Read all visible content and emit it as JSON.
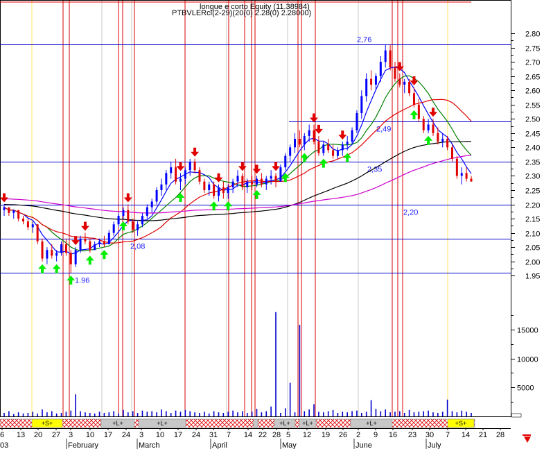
{
  "chart_data": {
    "type": "candlestick",
    "title": "longue e corto Equity (11.38984)",
    "subtitle": "PTBVLERcl(2-29)(20(0) 2.28(0) 2.28000)",
    "y_ticks": [
      "2.80",
      "2.75",
      "2.70",
      "2.65",
      "2.60",
      "2.55",
      "2.50",
      "2.45",
      "2.40",
      "2.35",
      "2.30",
      "2.25",
      "2.20",
      "2.15",
      "2.10",
      "2.05",
      "2.00",
      "1.95"
    ],
    "ylim": [
      1.925,
      2.845
    ],
    "volume_ticks": [
      "15000",
      "10000",
      "5000"
    ],
    "volume_lim": [
      0,
      20000
    ],
    "level_lines": [
      {
        "value": 2.76,
        "label": "2,76"
      },
      {
        "value": 2.49,
        "label": "2,49"
      },
      {
        "value": 2.35,
        "label": "2,35"
      },
      {
        "value": 2.2,
        "label": "2,20"
      },
      {
        "value": 2.08,
        "label": "2,08"
      },
      {
        "value": 1.96,
        "label": "1.96"
      }
    ],
    "day_labels": [
      "6",
      "13",
      "20",
      "27",
      "3",
      "10",
      "17",
      "24",
      "3",
      "10",
      "17",
      "24",
      "31",
      "7",
      "14",
      "22",
      "28",
      "5",
      "12",
      "19",
      "26",
      "2",
      "9",
      "16",
      "23",
      "30",
      "7",
      "14",
      "21",
      "28"
    ],
    "month_labels": [
      "03",
      "February",
      "March",
      "April",
      "May",
      "June",
      "July"
    ],
    "signal_bands": [
      "+S+",
      "+L+",
      "+L+",
      "+L+",
      "+L+",
      "+L+",
      "+S+"
    ],
    "candles": [
      {
        "o": 2.18,
        "h": 2.2,
        "l": 2.16,
        "c": 2.19
      },
      {
        "o": 2.19,
        "h": 2.19,
        "l": 2.16,
        "c": 2.17
      },
      {
        "o": 2.17,
        "h": 2.18,
        "l": 2.15,
        "c": 2.18
      },
      {
        "o": 2.18,
        "h": 2.18,
        "l": 2.14,
        "c": 2.15
      },
      {
        "o": 2.15,
        "h": 2.16,
        "l": 2.13,
        "c": 2.14
      },
      {
        "o": 2.14,
        "h": 2.15,
        "l": 2.11,
        "c": 2.12
      },
      {
        "o": 2.12,
        "h": 2.14,
        "l": 2.1,
        "c": 2.13
      },
      {
        "o": 2.13,
        "h": 2.13,
        "l": 2.06,
        "c": 2.07
      },
      {
        "o": 2.07,
        "h": 2.08,
        "l": 2.0,
        "c": 2.01
      },
      {
        "o": 2.01,
        "h": 2.05,
        "l": 1.99,
        "c": 2.04
      },
      {
        "o": 2.04,
        "h": 2.06,
        "l": 2.01,
        "c": 2.02
      },
      {
        "o": 2.02,
        "h": 2.04,
        "l": 2.0,
        "c": 2.03
      },
      {
        "o": 2.03,
        "h": 2.07,
        "l": 2.02,
        "c": 2.06
      },
      {
        "o": 2.06,
        "h": 2.08,
        "l": 2.02,
        "c": 2.03
      },
      {
        "o": 2.03,
        "h": 2.04,
        "l": 1.96,
        "c": 1.99
      },
      {
        "o": 1.99,
        "h": 2.05,
        "l": 1.98,
        "c": 2.04
      },
      {
        "o": 2.04,
        "h": 2.09,
        "l": 2.03,
        "c": 2.08
      },
      {
        "o": 2.08,
        "h": 2.1,
        "l": 2.06,
        "c": 2.07
      },
      {
        "o": 2.07,
        "h": 2.08,
        "l": 2.03,
        "c": 2.04
      },
      {
        "o": 2.04,
        "h": 2.07,
        "l": 2.04,
        "c": 2.06
      },
      {
        "o": 2.06,
        "h": 2.08,
        "l": 2.05,
        "c": 2.07
      },
      {
        "o": 2.07,
        "h": 2.09,
        "l": 2.05,
        "c": 2.06
      },
      {
        "o": 2.06,
        "h": 2.11,
        "l": 2.06,
        "c": 2.1
      },
      {
        "o": 2.1,
        "h": 2.14,
        "l": 2.09,
        "c": 2.13
      },
      {
        "o": 2.13,
        "h": 2.17,
        "l": 2.12,
        "c": 2.16
      },
      {
        "o": 2.16,
        "h": 2.19,
        "l": 2.15,
        "c": 2.18
      },
      {
        "o": 2.18,
        "h": 2.2,
        "l": 2.13,
        "c": 2.14
      },
      {
        "o": 2.14,
        "h": 2.15,
        "l": 2.1,
        "c": 2.11
      },
      {
        "o": 2.11,
        "h": 2.14,
        "l": 2.09,
        "c": 2.13
      },
      {
        "o": 2.13,
        "h": 2.17,
        "l": 2.12,
        "c": 2.16
      },
      {
        "o": 2.16,
        "h": 2.2,
        "l": 2.15,
        "c": 2.19
      },
      {
        "o": 2.19,
        "h": 2.22,
        "l": 2.17,
        "c": 2.21
      },
      {
        "o": 2.21,
        "h": 2.26,
        "l": 2.2,
        "c": 2.25
      },
      {
        "o": 2.25,
        "h": 2.29,
        "l": 2.23,
        "c": 2.27
      },
      {
        "o": 2.27,
        "h": 2.32,
        "l": 2.25,
        "c": 2.31
      },
      {
        "o": 2.31,
        "h": 2.35,
        "l": 2.29,
        "c": 2.33
      },
      {
        "o": 2.33,
        "h": 2.36,
        "l": 2.27,
        "c": 2.28
      },
      {
        "o": 2.28,
        "h": 2.31,
        "l": 2.25,
        "c": 2.29
      },
      {
        "o": 2.29,
        "h": 2.33,
        "l": 2.27,
        "c": 2.32
      },
      {
        "o": 2.32,
        "h": 2.36,
        "l": 2.3,
        "c": 2.35
      },
      {
        "o": 2.35,
        "h": 2.36,
        "l": 2.31,
        "c": 2.32
      },
      {
        "o": 2.32,
        "h": 2.33,
        "l": 2.27,
        "c": 2.28
      },
      {
        "o": 2.28,
        "h": 2.29,
        "l": 2.24,
        "c": 2.25
      },
      {
        "o": 2.25,
        "h": 2.28,
        "l": 2.23,
        "c": 2.27
      },
      {
        "o": 2.27,
        "h": 2.28,
        "l": 2.22,
        "c": 2.23
      },
      {
        "o": 2.23,
        "h": 2.27,
        "l": 2.21,
        "c": 2.26
      },
      {
        "o": 2.26,
        "h": 2.28,
        "l": 2.22,
        "c": 2.24
      },
      {
        "o": 2.24,
        "h": 2.27,
        "l": 2.22,
        "c": 2.26
      },
      {
        "o": 2.26,
        "h": 2.29,
        "l": 2.24,
        "c": 2.28
      },
      {
        "o": 2.28,
        "h": 2.32,
        "l": 2.26,
        "c": 2.3
      },
      {
        "o": 2.3,
        "h": 2.31,
        "l": 2.25,
        "c": 2.26
      },
      {
        "o": 2.26,
        "h": 2.29,
        "l": 2.24,
        "c": 2.28
      },
      {
        "o": 2.28,
        "h": 2.3,
        "l": 2.25,
        "c": 2.27
      },
      {
        "o": 2.27,
        "h": 2.3,
        "l": 2.26,
        "c": 2.29
      },
      {
        "o": 2.29,
        "h": 2.31,
        "l": 2.26,
        "c": 2.27
      },
      {
        "o": 2.27,
        "h": 2.3,
        "l": 2.25,
        "c": 2.29
      },
      {
        "o": 2.29,
        "h": 2.32,
        "l": 2.27,
        "c": 2.3
      },
      {
        "o": 2.3,
        "h": 2.31,
        "l": 2.26,
        "c": 2.28
      },
      {
        "o": 2.28,
        "h": 2.34,
        "l": 2.28,
        "c": 2.33
      },
      {
        "o": 2.33,
        "h": 2.38,
        "l": 2.32,
        "c": 2.37
      },
      {
        "o": 2.37,
        "h": 2.41,
        "l": 2.35,
        "c": 2.4
      },
      {
        "o": 2.4,
        "h": 2.45,
        "l": 2.38,
        "c": 2.43
      },
      {
        "o": 2.43,
        "h": 2.46,
        "l": 2.4,
        "c": 2.41
      },
      {
        "o": 2.41,
        "h": 2.45,
        "l": 2.39,
        "c": 2.44
      },
      {
        "o": 2.44,
        "h": 2.48,
        "l": 2.42,
        "c": 2.46
      },
      {
        "o": 2.46,
        "h": 2.48,
        "l": 2.41,
        "c": 2.42
      },
      {
        "o": 2.42,
        "h": 2.44,
        "l": 2.37,
        "c": 2.38
      },
      {
        "o": 2.38,
        "h": 2.42,
        "l": 2.37,
        "c": 2.41
      },
      {
        "o": 2.41,
        "h": 2.43,
        "l": 2.38,
        "c": 2.39
      },
      {
        "o": 2.39,
        "h": 2.41,
        "l": 2.36,
        "c": 2.37
      },
      {
        "o": 2.37,
        "h": 2.4,
        "l": 2.36,
        "c": 2.39
      },
      {
        "o": 2.39,
        "h": 2.42,
        "l": 2.37,
        "c": 2.41
      },
      {
        "o": 2.41,
        "h": 2.44,
        "l": 2.39,
        "c": 2.42
      },
      {
        "o": 2.42,
        "h": 2.47,
        "l": 2.41,
        "c": 2.46
      },
      {
        "o": 2.46,
        "h": 2.53,
        "l": 2.45,
        "c": 2.52
      },
      {
        "o": 2.52,
        "h": 2.6,
        "l": 2.5,
        "c": 2.58
      },
      {
        "o": 2.58,
        "h": 2.66,
        "l": 2.56,
        "c": 2.64
      },
      {
        "o": 2.64,
        "h": 2.67,
        "l": 2.6,
        "c": 2.62
      },
      {
        "o": 2.62,
        "h": 2.66,
        "l": 2.6,
        "c": 2.65
      },
      {
        "o": 2.65,
        "h": 2.72,
        "l": 2.63,
        "c": 2.7
      },
      {
        "o": 2.7,
        "h": 2.76,
        "l": 2.68,
        "c": 2.74
      },
      {
        "o": 2.74,
        "h": 2.76,
        "l": 2.67,
        "c": 2.68
      },
      {
        "o": 2.68,
        "h": 2.7,
        "l": 2.63,
        "c": 2.64
      },
      {
        "o": 2.64,
        "h": 2.66,
        "l": 2.61,
        "c": 2.62
      },
      {
        "o": 2.62,
        "h": 2.64,
        "l": 2.59,
        "c": 2.63
      },
      {
        "o": 2.63,
        "h": 2.64,
        "l": 2.58,
        "c": 2.59
      },
      {
        "o": 2.59,
        "h": 2.61,
        "l": 2.54,
        "c": 2.55
      },
      {
        "o": 2.55,
        "h": 2.57,
        "l": 2.49,
        "c": 2.5
      },
      {
        "o": 2.5,
        "h": 2.51,
        "l": 2.45,
        "c": 2.46
      },
      {
        "o": 2.46,
        "h": 2.5,
        "l": 2.45,
        "c": 2.48
      },
      {
        "o": 2.48,
        "h": 2.5,
        "l": 2.44,
        "c": 2.45
      },
      {
        "o": 2.45,
        "h": 2.47,
        "l": 2.41,
        "c": 2.42
      },
      {
        "o": 2.42,
        "h": 2.45,
        "l": 2.4,
        "c": 2.43
      },
      {
        "o": 2.43,
        "h": 2.44,
        "l": 2.39,
        "c": 2.4
      },
      {
        "o": 2.4,
        "h": 2.41,
        "l": 2.35,
        "c": 2.36
      },
      {
        "o": 2.36,
        "h": 2.37,
        "l": 2.29,
        "c": 2.3
      },
      {
        "o": 2.3,
        "h": 2.33,
        "l": 2.27,
        "c": 2.31
      },
      {
        "o": 2.31,
        "h": 2.33,
        "l": 2.28,
        "c": 2.29
      },
      {
        "o": 2.29,
        "h": 2.3,
        "l": 2.28,
        "c": 2.28
      }
    ],
    "volume": [
      600,
      900,
      400,
      700,
      500,
      600,
      800,
      500,
      1200,
      700,
      900,
      500,
      600,
      800,
      1000,
      3800,
      900,
      700,
      600,
      500,
      800,
      600,
      700,
      900,
      500,
      1100,
      700,
      900,
      600,
      1000,
      800,
      900,
      700,
      1200,
      900,
      600,
      1000,
      800,
      1100,
      900,
      700,
      600,
      800,
      500,
      900,
      700,
      600,
      800,
      1000,
      700,
      900,
      600,
      800,
      1300,
      700,
      900,
      1700,
      18000,
      600,
      1400,
      5800,
      700,
      15800,
      900,
      1200,
      2100,
      800,
      700,
      900,
      1100,
      600,
      800,
      700,
      900,
      1000,
      600,
      800,
      2800,
      1300,
      900,
      1200,
      700,
      800,
      900,
      600,
      1100,
      700,
      800,
      900,
      1000,
      700,
      600,
      800,
      2900,
      900,
      700,
      1000,
      800,
      600
    ]
  }
}
